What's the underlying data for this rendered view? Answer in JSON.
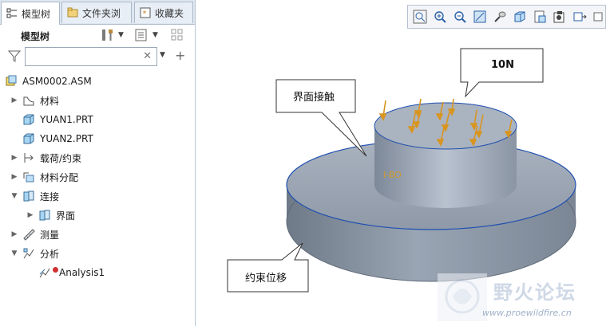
{
  "tabs": [
    {
      "label": "模型树",
      "icon": "model-tree-icon",
      "active": true
    },
    {
      "label": "文件夹浏",
      "icon": "folder-browser-icon",
      "active": false
    },
    {
      "label": "收藏夹",
      "icon": "favorites-icon",
      "active": false
    }
  ],
  "tree_header": {
    "title": "模型树",
    "settings_icon": "tools-icon",
    "show_icon": "list-icon"
  },
  "filter": {
    "value": "",
    "placeholder": ""
  },
  "tree": [
    {
      "label": "ASM0002.ASM",
      "icon": "assembly-icon",
      "expand": "none",
      "indent": 0
    },
    {
      "label": "材料",
      "icon": "material-icon",
      "expand": "collapsed",
      "indent": 1
    },
    {
      "label": "YUAN1.PRT",
      "icon": "part-icon",
      "expand": "none",
      "indent": 1
    },
    {
      "label": "YUAN2.PRT",
      "icon": "part-icon",
      "expand": "none",
      "indent": 1
    },
    {
      "label": "载荷/约束",
      "icon": "load-constraint-icon",
      "expand": "collapsed",
      "indent": 1
    },
    {
      "label": "材料分配",
      "icon": "material-assign-icon",
      "expand": "collapsed",
      "indent": 1
    },
    {
      "label": "连接",
      "icon": "connection-icon",
      "expand": "expanded",
      "indent": 1
    },
    {
      "label": "界面",
      "icon": "interface-icon",
      "expand": "collapsed",
      "indent": 2
    },
    {
      "label": "测量",
      "icon": "measure-icon",
      "expand": "collapsed",
      "indent": 1
    },
    {
      "label": "分析",
      "icon": "analysis-icon",
      "expand": "expanded",
      "indent": 1
    },
    {
      "label": "Analysis1",
      "icon": "analysis-run-icon",
      "expand": "none",
      "indent": 2
    }
  ],
  "callouts": {
    "force": "10N",
    "contact": "界面接触",
    "constraint": "约束位移"
  },
  "watermark": {
    "name": "野火论坛",
    "url": "www.proewildfire.cn"
  },
  "colors": {
    "accent": "#3a78c8",
    "model": "#8d98a8",
    "load": "#e0a020",
    "edge": "#1e4fb0"
  }
}
